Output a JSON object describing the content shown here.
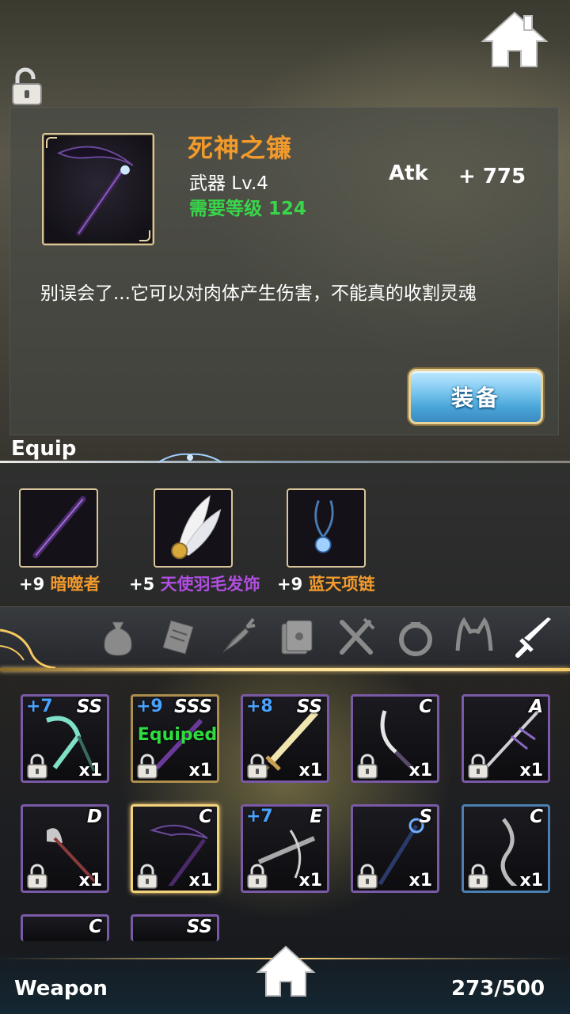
{
  "item": {
    "name": "死神之镰",
    "type_level": "武器 Lv.4",
    "req_label": "需要等级",
    "req_level": "124",
    "stat_name": "Atk",
    "stat_value": "+ 775",
    "description": "别误会了...它可以对肉体产生伤害，不能真的收割灵魂",
    "equip_button": "装备"
  },
  "equip": {
    "title": "Equip",
    "slots": [
      {
        "plus": "+9",
        "name": "暗噬者",
        "name_color": "#f29a2c"
      },
      {
        "plus": "+5",
        "name": "天使羽毛发饰",
        "name_color": "#b04ee0"
      },
      {
        "plus": "+9",
        "name": "蓝天项链",
        "name_color": "#f29a2c"
      }
    ]
  },
  "tabs": [
    {
      "icon": "bag-icon",
      "selected": false
    },
    {
      "icon": "scroll-icon",
      "selected": false
    },
    {
      "icon": "carrot-icon",
      "selected": false
    },
    {
      "icon": "book-icon",
      "selected": false
    },
    {
      "icon": "fork-knife-icon",
      "selected": false
    },
    {
      "icon": "ring-icon",
      "selected": false
    },
    {
      "icon": "cat-ears-icon",
      "selected": false
    },
    {
      "icon": "sword-icon",
      "selected": true
    }
  ],
  "inventory": [
    {
      "plus": "+7",
      "rank": "SS",
      "qty": "x1",
      "equipped": "",
      "frame": "purple",
      "art": "axe-teal"
    },
    {
      "plus": "+9",
      "rank": "SSS",
      "qty": "x1",
      "equipped": "Equiped",
      "frame": "gold",
      "art": "dagger-purple"
    },
    {
      "plus": "+8",
      "rank": "SS",
      "qty": "x1",
      "equipped": "",
      "frame": "purple",
      "art": "sword-gold"
    },
    {
      "plus": "",
      "rank": "C",
      "qty": "x1",
      "equipped": "",
      "frame": "purple",
      "art": "scimitar"
    },
    {
      "plus": "",
      "rank": "A",
      "qty": "x1",
      "equipped": "",
      "frame": "purple",
      "art": "spear-spiked"
    },
    {
      "plus": "",
      "rank": "D",
      "qty": "x1",
      "equipped": "",
      "frame": "purple",
      "art": "halberd"
    },
    {
      "plus": "",
      "rank": "C",
      "qty": "x1",
      "equipped": "",
      "frame": "selected",
      "art": "scythe"
    },
    {
      "plus": "+7",
      "rank": "E",
      "qty": "x1",
      "equipped": "",
      "frame": "purple",
      "art": "crossbow"
    },
    {
      "plus": "",
      "rank": "S",
      "qty": "x1",
      "equipped": "",
      "frame": "purple",
      "art": "staff-blue"
    },
    {
      "plus": "",
      "rank": "C",
      "qty": "x1",
      "equipped": "",
      "frame": "blue",
      "art": "staff-twisted"
    },
    {
      "plus": "",
      "rank": "C",
      "qty": "",
      "equipped": "",
      "frame": "purple",
      "art": ""
    },
    {
      "plus": "",
      "rank": "SS",
      "qty": "",
      "equipped": "",
      "frame": "purple",
      "art": ""
    }
  ],
  "footer": {
    "category": "Weapon",
    "count": "273/500"
  }
}
